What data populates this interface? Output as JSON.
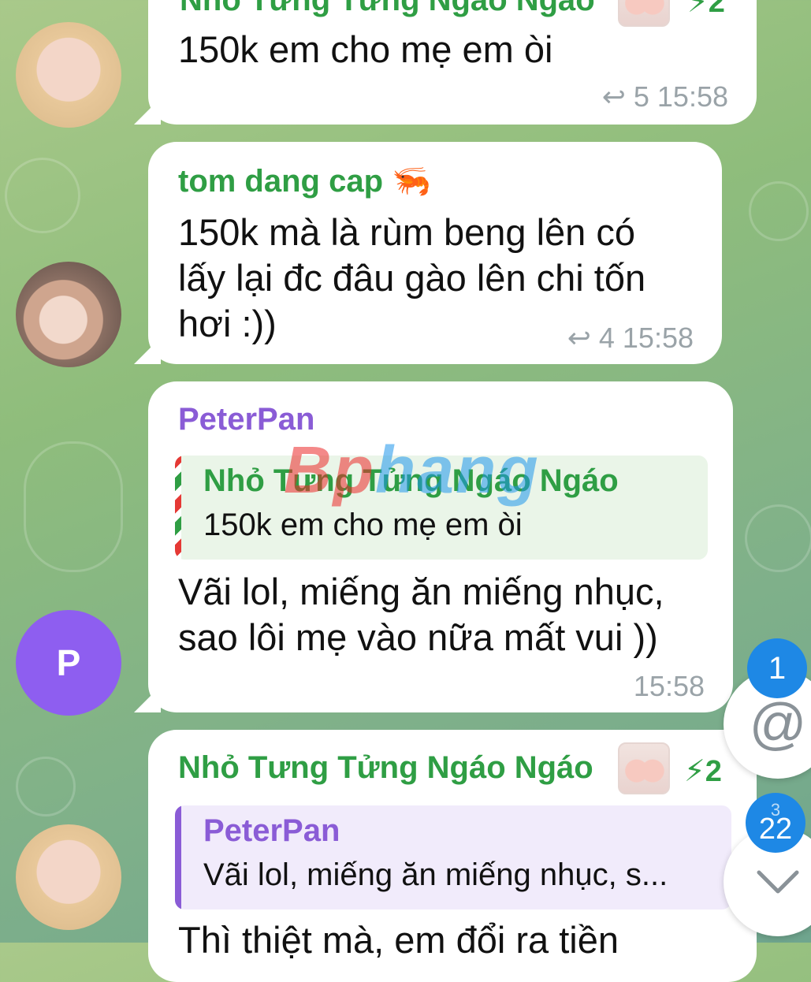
{
  "colors": {
    "green_name": "#2f9e44",
    "purple_name": "#8a5cd6",
    "bubble_bg": "#ffffff",
    "meta_gray": "#9aa3a8",
    "badge_blue": "#1e88e5"
  },
  "messages": [
    {
      "sender": "Nhỏ Tưng Tửng Ngáo Ngáo",
      "boost": "2",
      "lines": [
        "150k em cho mẹ em òi"
      ],
      "replies": "5",
      "time": "15:58"
    },
    {
      "sender": "tom dang cap",
      "sender_emoji": "🦐",
      "lines": [
        "150k mà là rùm beng lên có",
        "lấy lại đc đâu gào lên chi tốn",
        "hơi :))"
      ],
      "replies": "4",
      "time": "15:58"
    },
    {
      "sender": "PeterPan",
      "avatar_letter": "P",
      "quote": {
        "name": "Nhỏ Tưng Tửng Ngáo Ngáo",
        "text": "150k em cho mẹ em òi"
      },
      "lines": [
        "Vãi lol, miếng ăn miếng nhục,",
        "sao lôi mẹ vào nữa mất vui ))"
      ],
      "time": "15:58"
    },
    {
      "sender": "Nhỏ Tưng Tửng Ngáo Ngáo",
      "boost": "2",
      "quote": {
        "name": "PeterPan",
        "text": "Vãi lol, miếng ăn miếng nhục, s..."
      },
      "lines": [
        "Thì thiệt mà, em đổi ra tiền"
      ]
    }
  ],
  "watermark": {
    "part1": "Bp",
    "part2": "hang"
  },
  "floating": {
    "mentions_badge": "1",
    "unread_badge": "22",
    "unread_badge_top": "3"
  }
}
